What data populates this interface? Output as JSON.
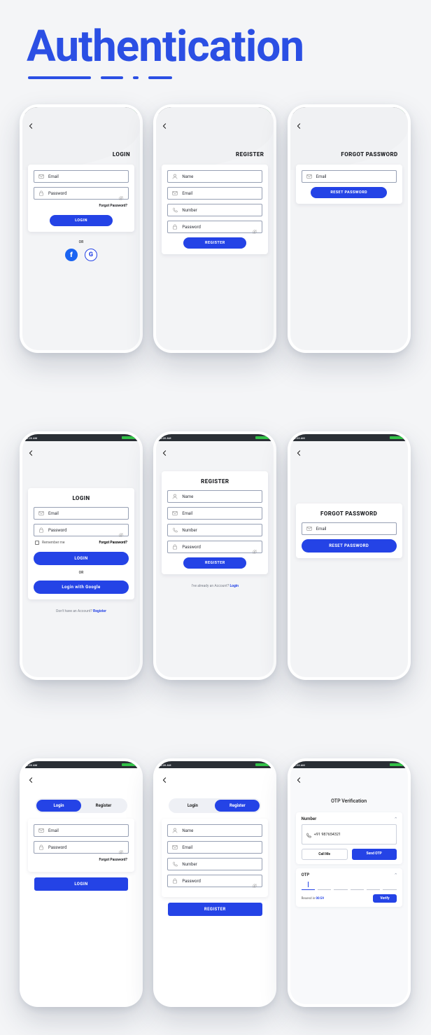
{
  "page": {
    "title": "Authentication"
  },
  "status": {
    "time": "2:26 AM"
  },
  "icons": {
    "back": "back-arrow",
    "user": "user",
    "email": "mail",
    "lock": "lock",
    "phone": "phone",
    "eye": "eye",
    "expand": "⌃"
  },
  "placeholders": {
    "name": "Name",
    "email": "Email",
    "password": "Password",
    "number": "Number"
  },
  "headings": {
    "login": "LOGIN",
    "register": "REGISTER",
    "forgot": "FORGOT PASSWORD",
    "otp_title": "OTP Verification"
  },
  "buttons": {
    "login": "LOGIN",
    "register": "REGISTER",
    "reset": "RESET PASSWORD",
    "login_google": "Login with Google",
    "call_me": "Call Me",
    "send_otp": "Send OTP",
    "verify": "Verify"
  },
  "links": {
    "forgot": "Forgot Password?",
    "no_account_prefix": "Don't have an Account?  ",
    "no_account_action": "Register",
    "have_account_prefix": "I've already an Account?  ",
    "have_account_action": "Login"
  },
  "labels": {
    "remember": "Remember me",
    "or": "OR",
    "number": "Number",
    "otp": "OTP",
    "resend_prefix": "Resend in  ",
    "resend_time": "00:59"
  },
  "tabs": {
    "login": "Login",
    "register": "Register"
  },
  "otp": {
    "phone": "+91 987654321"
  },
  "social": {
    "facebook": "f",
    "google": "G"
  }
}
